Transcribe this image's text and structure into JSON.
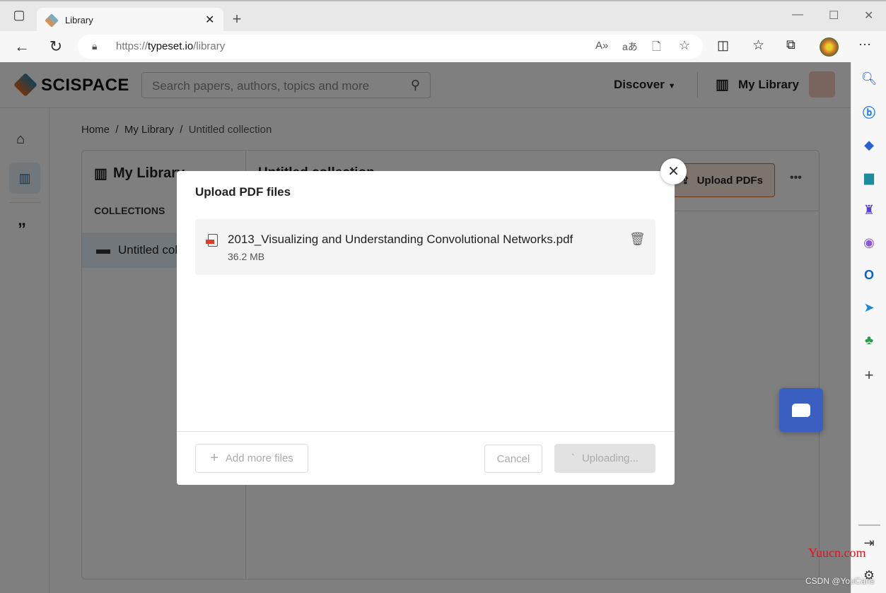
{
  "browser": {
    "tab_title": "Library",
    "url_prefix": "https://",
    "url_domain": "typeset.io",
    "url_path": "/library"
  },
  "header": {
    "logo": "SCISPACE",
    "search_placeholder": "Search papers, authors, topics and more",
    "discover": "Discover",
    "my_library": "My Library"
  },
  "breadcrumb": [
    "Home",
    "My Library",
    "Untitled collection"
  ],
  "library": {
    "title": "My Library",
    "collections_label": "COLLECTIONS",
    "collection_item": "Untitled collection",
    "collection_title": "Untitled collection",
    "upload_button": "Upload PDFs"
  },
  "modal": {
    "title": "Upload PDF files",
    "file": {
      "name": "2013_Visualizing and Understanding Convolutional Networks.pdf",
      "size": "36.2 MB"
    },
    "add_more": "Add more files",
    "cancel": "Cancel",
    "uploading": "Uploading..."
  },
  "watermark": {
    "site": "Yuucn.com",
    "author": "CSDN @YouCans"
  },
  "colors": {
    "accent": "#e06a1f",
    "chat": "#3b5fc0"
  }
}
